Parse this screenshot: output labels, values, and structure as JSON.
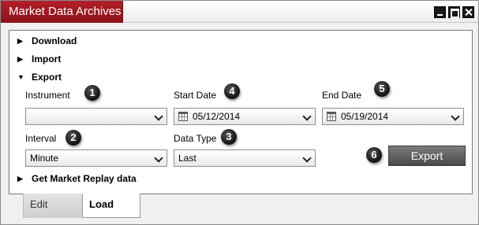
{
  "window": {
    "title": "Market Data Archives"
  },
  "sections": {
    "download": "Download",
    "import": "Import",
    "export": "Export",
    "market_replay": "Get Market Replay data"
  },
  "export_form": {
    "instrument": {
      "label": "Instrument",
      "value": "",
      "badge": "1"
    },
    "start_date": {
      "label": "Start Date",
      "value": "05/12/2014",
      "badge": "4"
    },
    "end_date": {
      "label": "End Date",
      "value": "05/19/2014",
      "badge": "5"
    },
    "interval": {
      "label": "Interval",
      "value": "Minute",
      "badge": "2"
    },
    "data_type": {
      "label": "Data Type",
      "value": "Last",
      "badge": "3"
    },
    "export_button": {
      "label": "Export",
      "badge": "6"
    }
  },
  "tabs": {
    "edit": "Edit",
    "load": "Load"
  },
  "colors": {
    "title_tab": "#9e1821",
    "button": "#5e5e5e"
  }
}
